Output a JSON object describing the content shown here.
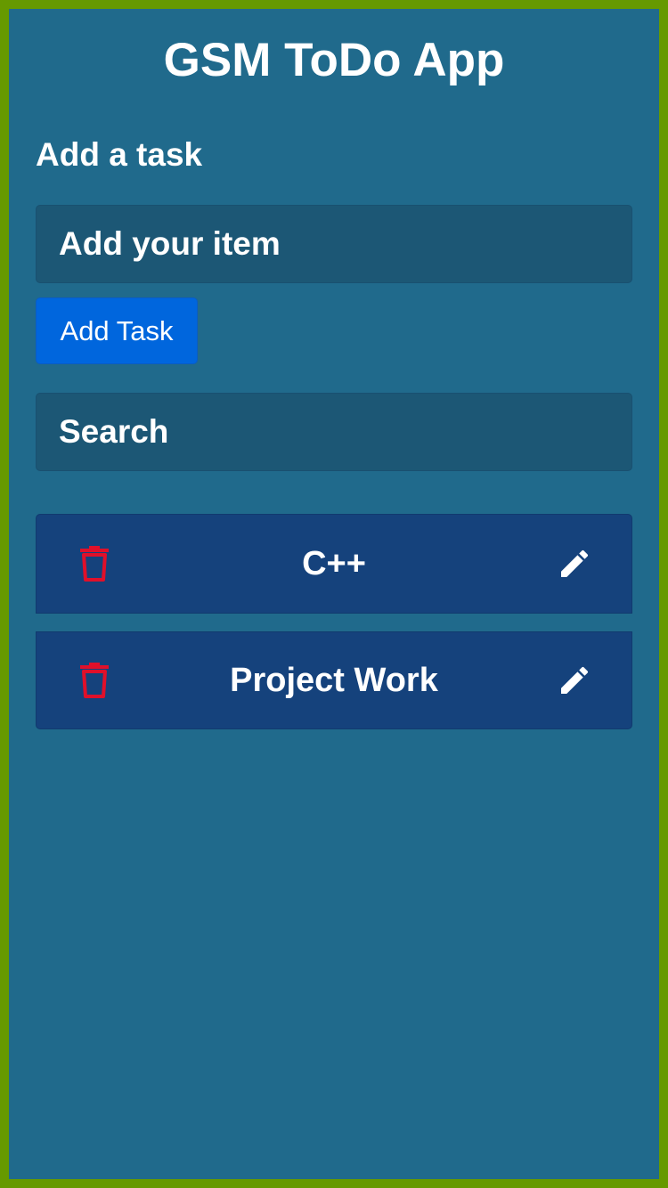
{
  "app": {
    "title": "GSM ToDo App"
  },
  "add_section": {
    "heading": "Add a task",
    "input_placeholder": "Add your item",
    "input_value": "",
    "button_label": "Add Task"
  },
  "search": {
    "placeholder": "Search",
    "value": ""
  },
  "tasks": [
    {
      "label": "C++",
      "delete_icon": "trash-icon",
      "edit_icon": "pencil-icon"
    },
    {
      "label": "Project Work",
      "delete_icon": "trash-icon",
      "edit_icon": "pencil-icon"
    }
  ],
  "colors": {
    "border": "#669900",
    "background": "#206a8c",
    "input_background": "#1c5775",
    "button": "#0066dd",
    "task_background": "#15427c",
    "delete_icon": "#e0102a",
    "text": "#ffffff"
  }
}
